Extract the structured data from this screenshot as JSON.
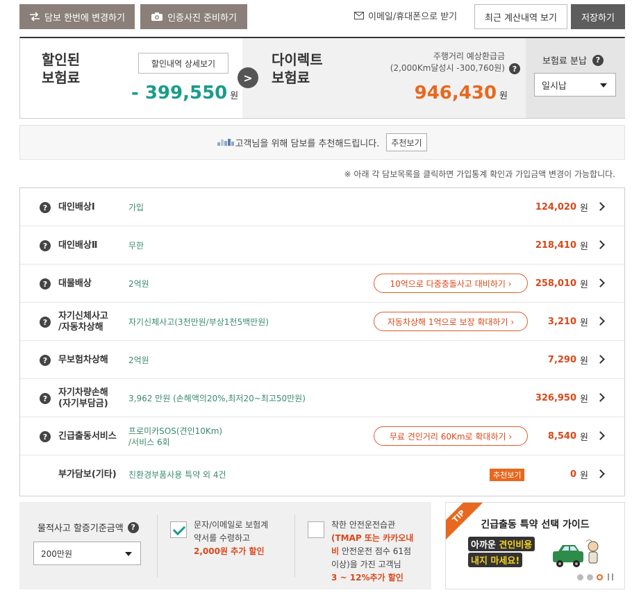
{
  "toolbar": {
    "swap_label": "담보 한번에 변경하기",
    "photo_label": "인증사진 준비하기",
    "email_label": "이메일/휴대폰으로 받기",
    "recent_label": "최근 계산내역 보기",
    "save_label": "저장하기"
  },
  "summary": {
    "discount_title_1": "할인된",
    "discount_title_2": "보험료",
    "detail_label": "할인내역 상세보기",
    "discount_amount": "- 399,550",
    "won": "원",
    "direct_title_1": "다이렉트",
    "direct_title_2": "보험료",
    "mileage_line_1": "주행거리 예상환급금",
    "mileage_line_2": "(2,000Km달성시 -300,760원)",
    "total_amount": "946,430",
    "installment_label": "보험료 분납",
    "installment_value": "일시납"
  },
  "recommend": {
    "text": "고객님을 위해 담보를 추천해드립니다.",
    "button": "추천보기"
  },
  "note": "※ 아래 각 담보목록을 클릭하면 가입통계 확인과 가입금액 변경이 가능합니다.",
  "coverages": [
    {
      "name_1": "대인배상Ⅰ",
      "name_2": "",
      "value_1": "가입",
      "value_2": "",
      "promo": "",
      "price": "124,020"
    },
    {
      "name_1": "대인배상Ⅱ",
      "name_2": "",
      "value_1": "무한",
      "value_2": "",
      "promo": "",
      "price": "218,410"
    },
    {
      "name_1": "대물배상",
      "name_2": "",
      "value_1": "2억원",
      "value_2": "",
      "promo": "10억으로 다중충돌사고 대비하기 ›",
      "price": "258,010"
    },
    {
      "name_1": "자기신체사고",
      "name_2": "/자동차상해",
      "value_1": "자기신체사고(3천만원/부상1천5백만원)",
      "value_2": "",
      "promo": "자동차상해 1억으로 보장 확대하기 ›",
      "price": "3,210"
    },
    {
      "name_1": "무보험차상해",
      "name_2": "",
      "value_1": "2억원",
      "value_2": "",
      "promo": "",
      "price": "7,290"
    },
    {
      "name_1": "자기차량손해",
      "name_2": "(자기부담금)",
      "value_1": "3,962 만원 (손해액의20%,최저20~최고50만원)",
      "value_2": "",
      "promo": "",
      "price": "326,950"
    },
    {
      "name_1": "긴급출동서비스",
      "name_2": "",
      "value_1": "프로미카SOS(견인10Km)",
      "value_2": "/서비스 6회",
      "promo": "무료 견인거리 60Km로 확대하기 ›",
      "price": "8,540"
    },
    {
      "name_1": "부가담보(기타)",
      "name_2": "",
      "value_1": "친환경부품사용 특약 외 4건",
      "value_2": "",
      "promo_tag": "추천보기",
      "price": "0"
    }
  ],
  "bottom": {
    "threshold_label": "물적사고 할증기준금액",
    "threshold_value": "200만원",
    "opt1_line1": "문자/이메일로 보험계",
    "opt1_line2": "약서를 수령하고",
    "opt1_em": "2,000원 추가 할인",
    "opt2_line1": "착한 안전운전습관",
    "opt2_em1": "(TMAP 또는 카카오내",
    "opt2_em2": "비",
    "opt2_line2": " 안전운전 점수 61점",
    "opt2_line3": "이상)을 가진 고객님",
    "opt2_em3": "3 ~ 12%추가 할인"
  },
  "tip": {
    "ribbon": "TIP",
    "title": "긴급출동 특약 선택 가이드",
    "banner_1a": "아까운 ",
    "banner_1b": "견인비용",
    "banner_2": "내지 마세요!"
  },
  "colors": {
    "accent_green": "#1a9c8b",
    "accent_orange": "#e8681f",
    "price_red": "#d9481a"
  }
}
